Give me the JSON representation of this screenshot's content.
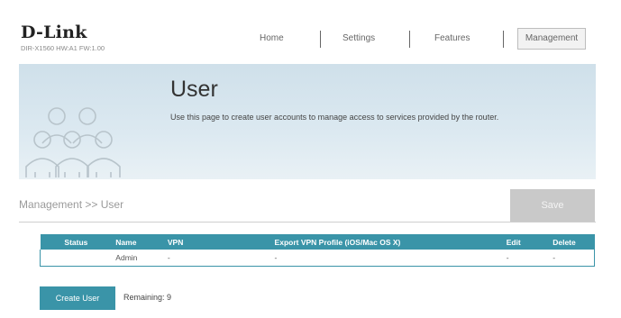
{
  "header": {
    "logo": "D-Link",
    "device": "DIR-X1560 HW:A1 FW:1.00",
    "nav": [
      "Home",
      "Settings",
      "Features",
      "Management"
    ]
  },
  "banner": {
    "title": "User",
    "description": "Use this page to create user accounts to manage access to services provided by the router."
  },
  "breadcrumb": "Management >> User",
  "save_label": "Save",
  "table": {
    "headers": [
      "Status",
      "Name",
      "VPN",
      "Export VPN Profile (iOS/Mac OS X)",
      "Edit",
      "Delete"
    ],
    "rows": [
      {
        "status": "",
        "name": "Admin",
        "vpn": "-",
        "export": "-",
        "edit": "-",
        "delete": "-"
      }
    ]
  },
  "create_user_label": "Create User",
  "remaining_label": "Remaining: 9",
  "colors": {
    "accent": "#3a94a8",
    "save_disabled": "#c9c9c9",
    "banner": "#d6e5ee"
  }
}
